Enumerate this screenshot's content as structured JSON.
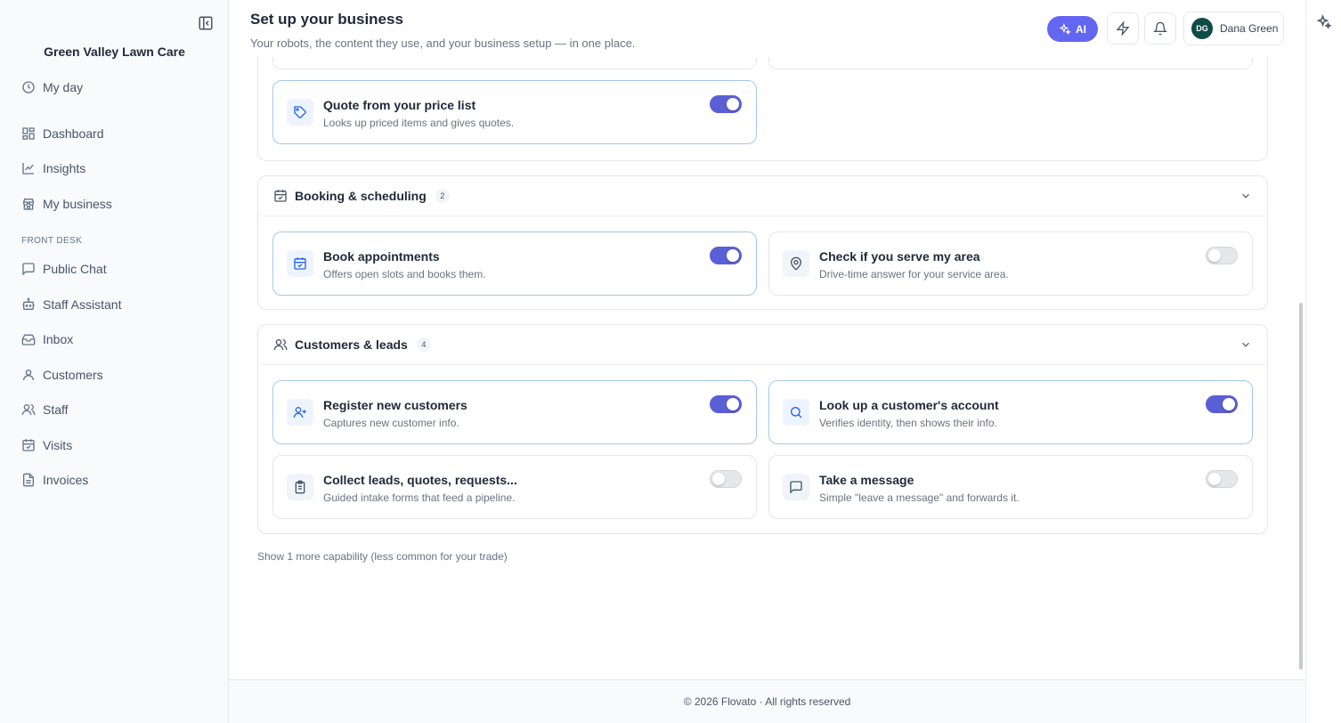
{
  "app": {
    "business_name": "Green Valley Lawn Care"
  },
  "sidebar": {
    "items": [
      {
        "label": "My day",
        "icon": "clock-icon"
      },
      {
        "label": "Dashboard",
        "icon": "dashboard-icon"
      },
      {
        "label": "Insights",
        "icon": "chart-line-icon"
      },
      {
        "label": "My business",
        "icon": "store-icon"
      },
      {
        "label": "Public Chat",
        "icon": "chat-bubble-icon"
      },
      {
        "label": "Staff Assistant",
        "icon": "robot-icon"
      },
      {
        "label": "Inbox",
        "icon": "inbox-icon"
      },
      {
        "label": "Customers",
        "icon": "user-icon"
      },
      {
        "label": "Staff",
        "icon": "users-icon"
      },
      {
        "label": "Visits",
        "icon": "calendar-check-icon"
      },
      {
        "label": "Invoices",
        "icon": "document-icon"
      }
    ],
    "section_label": "FRONT DESK"
  },
  "header": {
    "title": "Set up your business",
    "subtitle": "Your robots, the content they use, and your business setup — in one place.",
    "ai_label": "AI",
    "user_initials": "DG",
    "user_name": "Dana Green"
  },
  "groups": [
    {
      "cards": [
        {
          "title": "Quote from your price list",
          "desc": "Looks up priced items and gives quotes.",
          "enabled": true,
          "icon": "tag-icon"
        }
      ]
    },
    {
      "title": "Booking & scheduling",
      "count": "2",
      "cards": [
        {
          "title": "Book appointments",
          "desc": "Offers open slots and books them.",
          "enabled": true,
          "icon": "calendar-check-icon"
        },
        {
          "title": "Check if you serve my area",
          "desc": "Drive-time answer for your service area.",
          "enabled": false,
          "icon": "map-pin-icon"
        }
      ]
    },
    {
      "title": "Customers & leads",
      "count": "4",
      "cards": [
        {
          "title": "Register new customers",
          "desc": "Captures new customer info.",
          "enabled": true,
          "icon": "user-plus-icon"
        },
        {
          "title": "Look up a customer's account",
          "desc": "Verifies identity, then shows their info.",
          "enabled": true,
          "icon": "search-icon"
        },
        {
          "title": "Collect leads, quotes, requests...",
          "desc": "Guided intake forms that feed a pipeline.",
          "enabled": false,
          "icon": "clipboard-icon"
        },
        {
          "title": "Take a message",
          "desc": "Simple \"leave a message\" and forwards it.",
          "enabled": false,
          "icon": "message-square-icon"
        }
      ]
    }
  ],
  "show_more": "Show 1 more capability (less common for your trade)",
  "footer": "© 2026 Flovato · All rights reserved",
  "colors": {
    "accent": "#5b5fd6",
    "ai_button": "#6366f1",
    "avatar": "#0f4c45",
    "active_card_border": "#a5c8ee"
  }
}
